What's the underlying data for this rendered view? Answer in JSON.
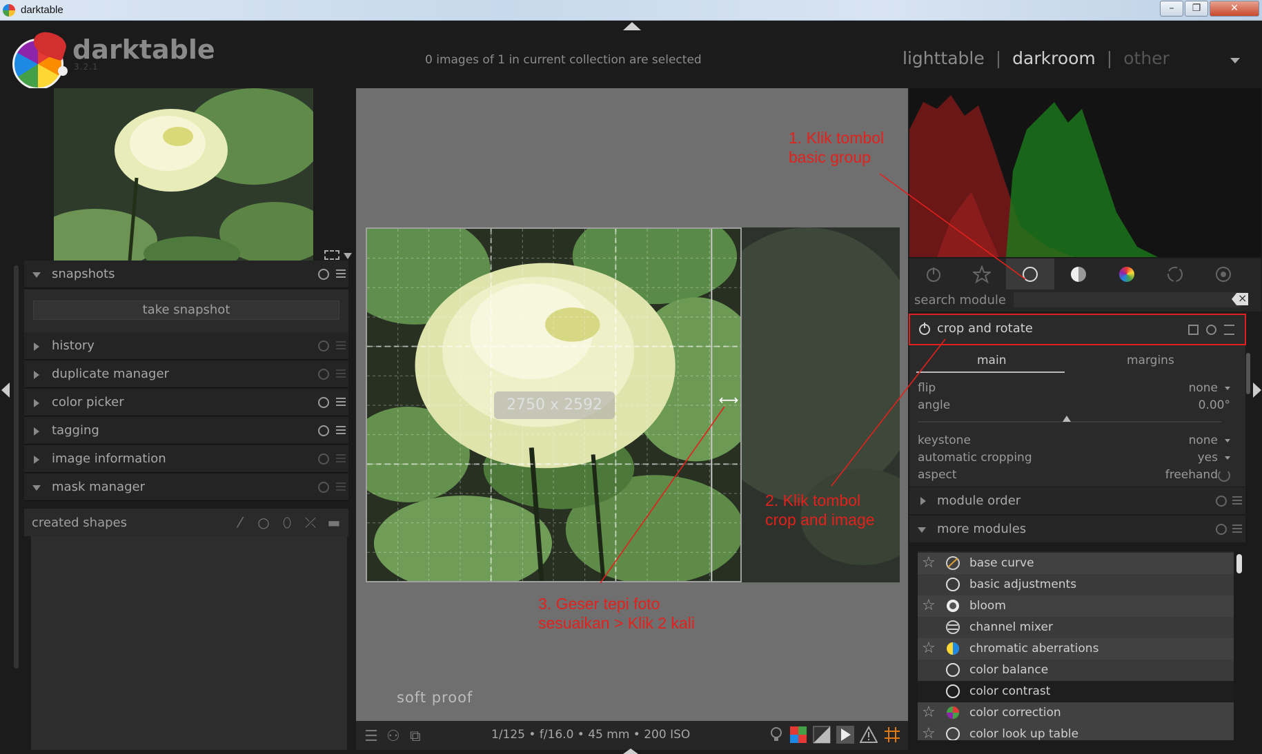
{
  "os_window": {
    "title": "darktable"
  },
  "header": {
    "app_name": "darktable",
    "version": "3.2.1",
    "selection_status": "0 images of 1 in current collection are selected",
    "views": [
      {
        "label": "lighttable",
        "state": "normal"
      },
      {
        "label": "darkroom",
        "state": "active"
      },
      {
        "label": "other",
        "state": "dim"
      }
    ],
    "separator": "|"
  },
  "left_panel": {
    "modules": [
      {
        "label": "snapshots",
        "expanded": true
      },
      {
        "label": "history",
        "expanded": false
      },
      {
        "label": "duplicate manager",
        "expanded": false
      },
      {
        "label": "color picker",
        "expanded": false
      },
      {
        "label": "tagging",
        "expanded": false
      },
      {
        "label": "image information",
        "expanded": false
      },
      {
        "label": "mask manager",
        "expanded": true
      }
    ],
    "snapshot_button": "take snapshot",
    "created_shapes_label": "created shapes"
  },
  "center": {
    "crop_size_label": "2750 x 2592",
    "soft_proof_label": "soft proof",
    "exif": "1/125 • f/16.0 • 45 mm • 200 ISO"
  },
  "right_panel": {
    "search_label": "search module",
    "search_value": "",
    "active_module": {
      "label": "crop and rotate",
      "tabs": [
        "main",
        "margins"
      ],
      "active_tab": "main",
      "params": [
        {
          "key": "flip",
          "value": "none",
          "dropdown": true
        },
        {
          "key": "angle",
          "value": "0.00°",
          "dropdown": false
        },
        {
          "key": "keystone",
          "value": "none",
          "dropdown": true
        },
        {
          "key": "automatic cropping",
          "value": "yes",
          "dropdown": true
        },
        {
          "key": "aspect",
          "value": "freehand",
          "dropdown": false
        }
      ],
      "angle_level": 0.5
    },
    "module_order_label": "module order",
    "more_modules_label": "more modules",
    "more_modules": [
      {
        "label": "base curve",
        "favorite": true,
        "style": "fav",
        "icon": "curve-icon"
      },
      {
        "label": "basic adjustments",
        "favorite": false,
        "style": "plain",
        "icon": "circle-icon"
      },
      {
        "label": "bloom",
        "favorite": true,
        "style": "fav",
        "icon": "bloom-icon"
      },
      {
        "label": "channel mixer",
        "favorite": false,
        "style": "plain",
        "icon": "mixer-icon"
      },
      {
        "label": "chromatic aberrations",
        "favorite": true,
        "style": "fav",
        "icon": "chromatic-icon"
      },
      {
        "label": "color balance",
        "favorite": false,
        "style": "plain",
        "icon": "circle-icon"
      },
      {
        "label": "color contrast",
        "favorite": false,
        "style": "dark",
        "icon": "circle-icon"
      },
      {
        "label": "color correction",
        "favorite": true,
        "style": "fav",
        "icon": "color-wheel-icon"
      },
      {
        "label": "color look up table",
        "favorite": true,
        "style": "fav",
        "icon": "circle-icon"
      }
    ]
  },
  "annotations": [
    {
      "id": "annot-1",
      "lines": [
        "1. Klik tombol",
        "basic group"
      ]
    },
    {
      "id": "annot-2",
      "lines": [
        "2. Klik tombol",
        "crop and image"
      ]
    },
    {
      "id": "annot-3",
      "lines": [
        "3. Geser tepi foto",
        "sesuaikan > Klik 2 kali"
      ]
    }
  ],
  "colors": {
    "annotation_red": "#e3211c",
    "panel_bg": "#262626",
    "center_bg": "#6f6f6f"
  }
}
